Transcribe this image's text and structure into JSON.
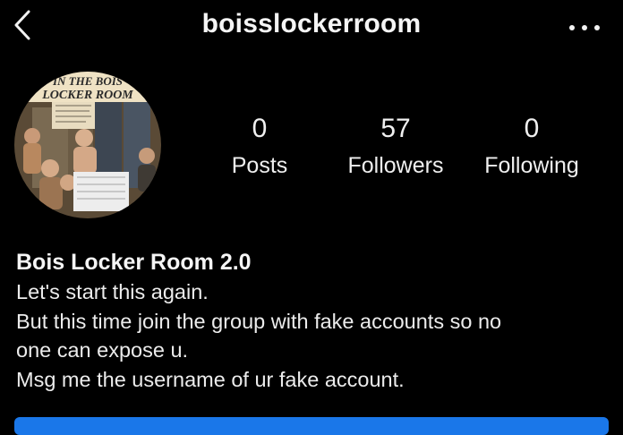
{
  "header": {
    "username": "boisslockerroom",
    "back_icon": "chevron-left-icon",
    "more_icon": "more-horizontal-icon"
  },
  "profile": {
    "avatar_text_line1": "IN THE BOIS",
    "avatar_text_line2": "LOCKER ROOM",
    "stats": [
      {
        "value": "0",
        "label": "Posts"
      },
      {
        "value": "57",
        "label": "Followers"
      },
      {
        "value": "0",
        "label": "Following"
      }
    ]
  },
  "bio": {
    "name": "Bois Locker Room 2.0",
    "lines": [
      "Let's start this again.",
      "But this time join the group with fake accounts so no",
      "one can expose u.",
      "Msg me the username of ur fake account."
    ]
  },
  "colors": {
    "background": "#000000",
    "text": "#f2f2f2",
    "accent_button": "#1a77e9"
  }
}
